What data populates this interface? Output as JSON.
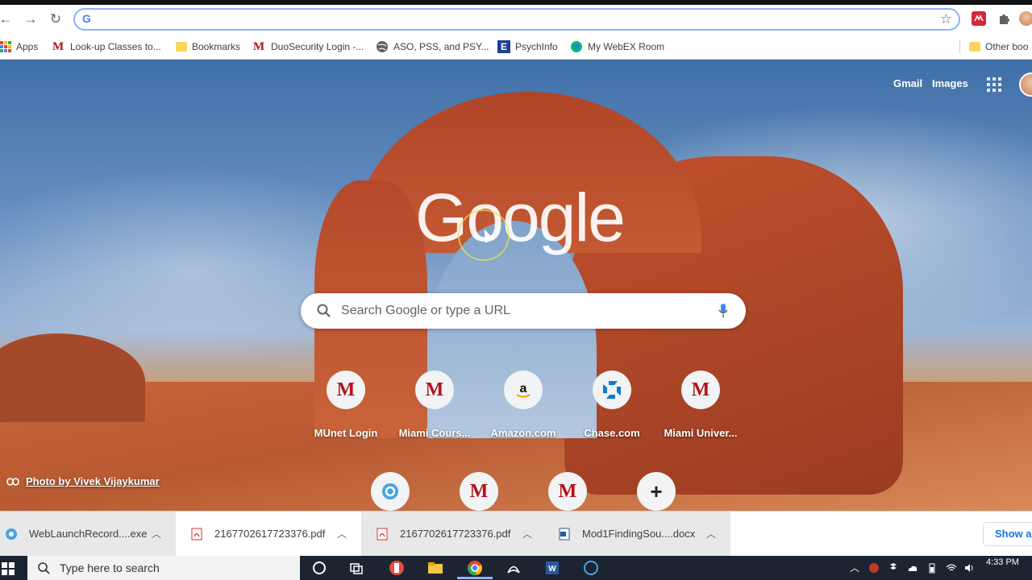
{
  "browser": {
    "omnibox_value": "",
    "nav": {
      "back": "←",
      "forward": "→",
      "reload": "↻"
    }
  },
  "bookmarks": [
    {
      "label": "Apps",
      "icon": "apps-grid-icon"
    },
    {
      "label": "Look-up Classes to...",
      "icon": "miami-m-icon"
    },
    {
      "label": "Bookmarks",
      "icon": "folder-icon"
    },
    {
      "label": "DuoSecurity Login -...",
      "icon": "miami-m-icon"
    },
    {
      "label": "ASO, PSS, and PSY...",
      "icon": "globe-icon"
    },
    {
      "label": "PsychInfo",
      "icon": "ebsco-icon"
    },
    {
      "label": "My WebEX Room",
      "icon": "webex-icon"
    },
    {
      "label": "Other boo",
      "icon": "folder-icon"
    }
  ],
  "ntp": {
    "gmail": "Gmail",
    "images": "Images",
    "logo": "Google",
    "search_placeholder": "Search Google or type a URL",
    "tiles_row1": [
      {
        "label": "MUnet Login",
        "icon": "miami-m-icon"
      },
      {
        "label": "Miami Cours...",
        "icon": "miami-m-icon"
      },
      {
        "label": "Amazon.com",
        "icon": "amazon-icon"
      },
      {
        "label": "Chase.com",
        "icon": "chase-icon"
      },
      {
        "label": "Miami Univer...",
        "icon": "miami-m-icon"
      }
    ],
    "tiles_row2": [
      {
        "label": "",
        "icon": "webex-icon"
      },
      {
        "label": "",
        "icon": "miami-m-icon"
      },
      {
        "label": "",
        "icon": "miami-m-icon"
      },
      {
        "label": "",
        "icon": "add-shortcut-icon"
      }
    ],
    "photo_credit": "Photo by Vivek Vijaykumar"
  },
  "downloads": {
    "items": [
      {
        "name": "WebLaunchRecord....exe",
        "icon": "webex-icon"
      },
      {
        "name": "2167702617723376.pdf",
        "icon": "pdf-icon"
      },
      {
        "name": "2167702617723376.pdf",
        "icon": "pdf-icon"
      },
      {
        "name": "Mod1FindingSou....docx",
        "icon": "word-icon"
      }
    ],
    "show_all": "Show all"
  },
  "taskbar": {
    "search_placeholder": "Type here to search",
    "time": "4:33 PM"
  },
  "colors": {
    "accent": "#1a73e8",
    "miami_red": "#b3121b",
    "omnibox_focus": "#8ab4f8",
    "taskbar": "#1b2430"
  }
}
